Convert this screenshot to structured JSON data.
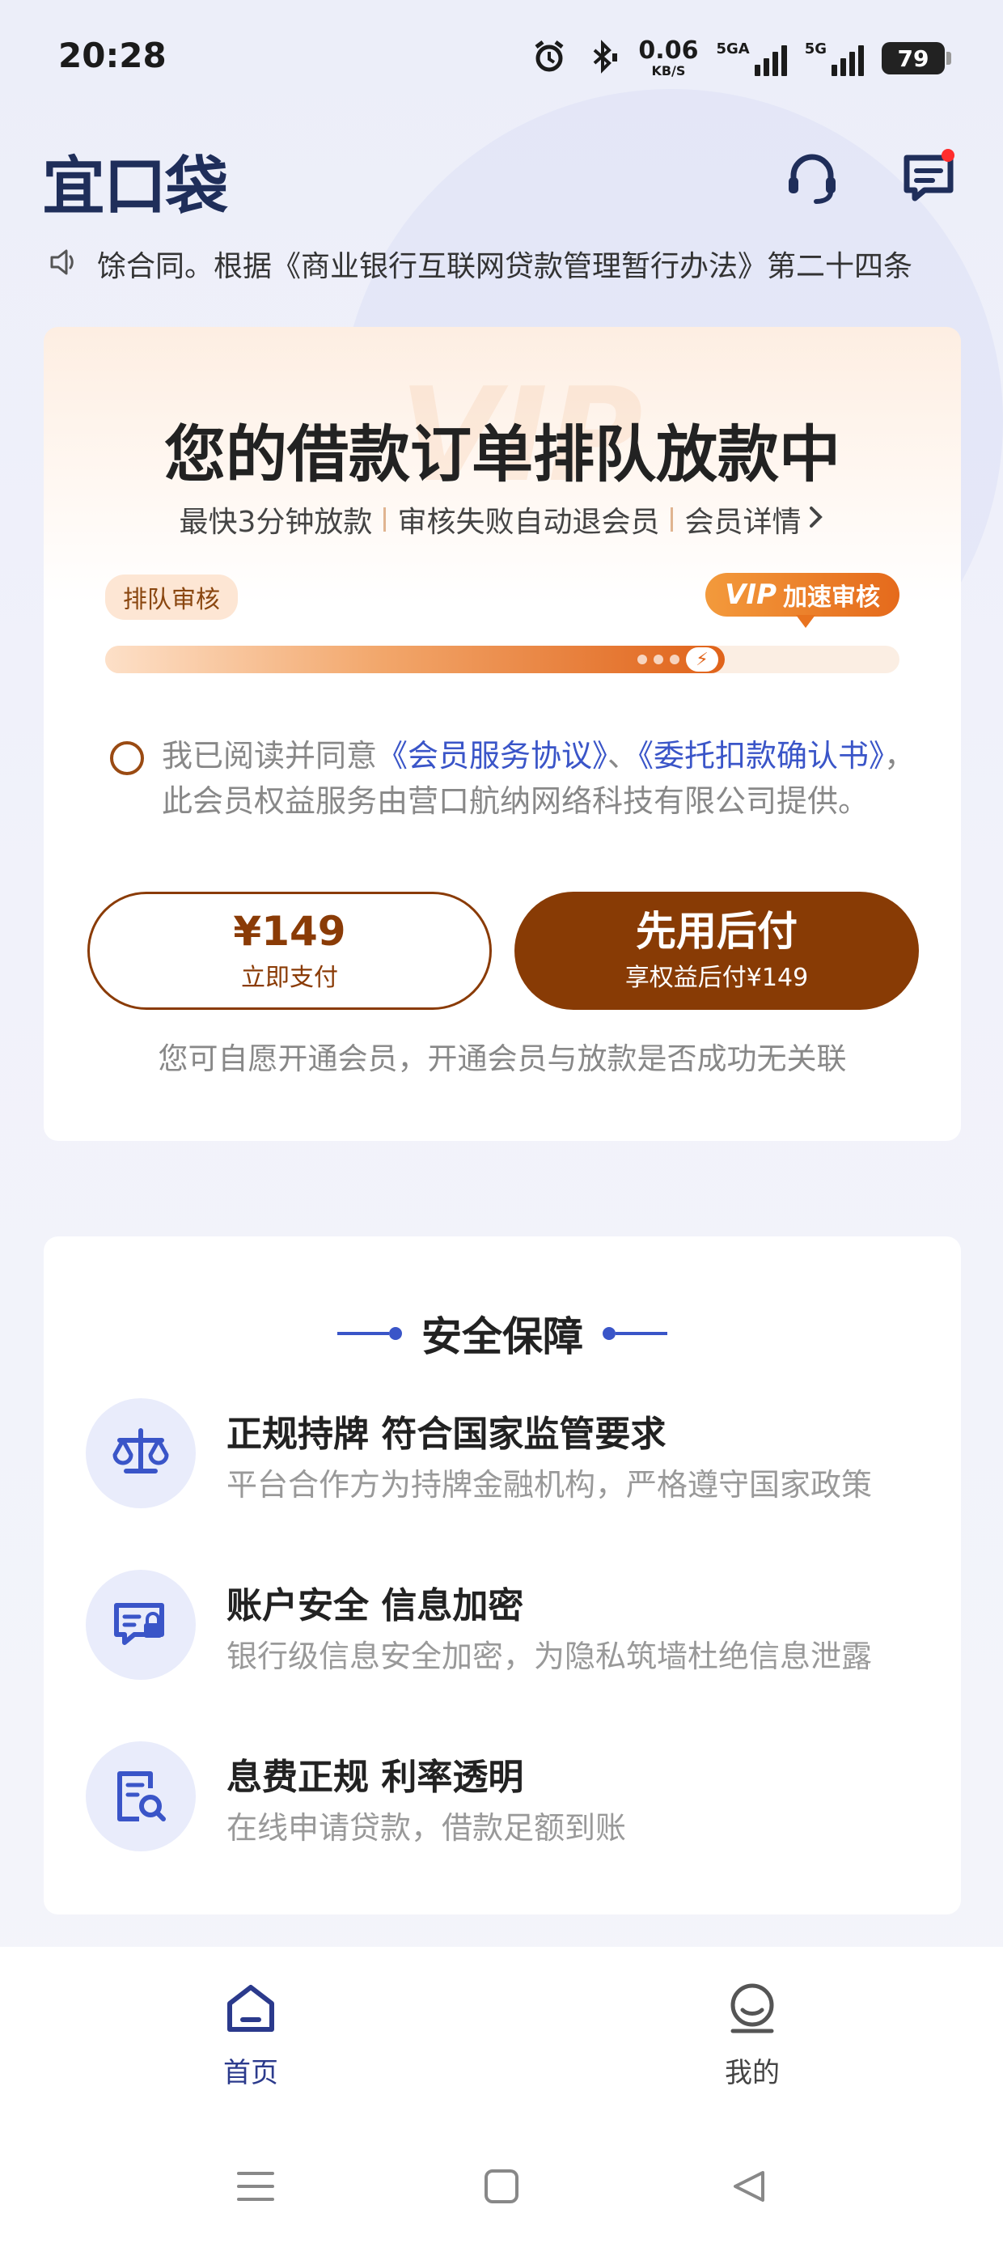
{
  "status_bar": {
    "time": "20:28",
    "net_speed": "0.06",
    "net_unit": "KB/S",
    "sim1_label": "5GA",
    "sim2_label": "5G",
    "battery": "79"
  },
  "header": {
    "logo": "宜口袋"
  },
  "marquee": {
    "text": "馀合同。根据《商业银行互联网贷款管理暂行办法》第二十四条"
  },
  "vip_card": {
    "watermark": "VIP",
    "title": "您的借款订单排队放款中",
    "sub_items": [
      "最快3分钟放款",
      "审核失败自动退会员",
      "会员详情"
    ],
    "queue_tag": "排队审核",
    "vip_tag_vip": "VIP",
    "vip_tag_label": "加速审核",
    "progress": 0.78,
    "agreement_prefix": "我已阅读并同意",
    "agreement_link1": "《会员服务协议》",
    "agreement_sep": "、",
    "agreement_link2": "《委托扣款确认书》",
    "agreement_suffix": "，此会员权益服务由营口航纳网络科技有限公司提供。",
    "pay_price": "¥149",
    "pay_label": "立即支付",
    "later_label": "先用后付",
    "later_sub": "享权益后付¥149",
    "note": "您可自愿开通会员，开通会员与放款是否成功无关联"
  },
  "safety": {
    "title": "安全保障",
    "items": [
      {
        "icon": "scale-icon",
        "title": "正规持牌 符合国家监管要求",
        "desc": "平台合作方为持牌金融机构，严格遵守国家政策"
      },
      {
        "icon": "secure-card-icon",
        "title": "账户安全 信息加密",
        "desc": "银行级信息安全加密，为隐私筑墙杜绝信息泄露"
      },
      {
        "icon": "document-search-icon",
        "title": "息费正规  利率透明",
        "desc": "在线申请贷款，借款足额到账"
      }
    ]
  },
  "bottom_nav": {
    "home": "首页",
    "mine": "我的",
    "active_color": "#2b3a8c",
    "inactive_color": "#444444"
  }
}
